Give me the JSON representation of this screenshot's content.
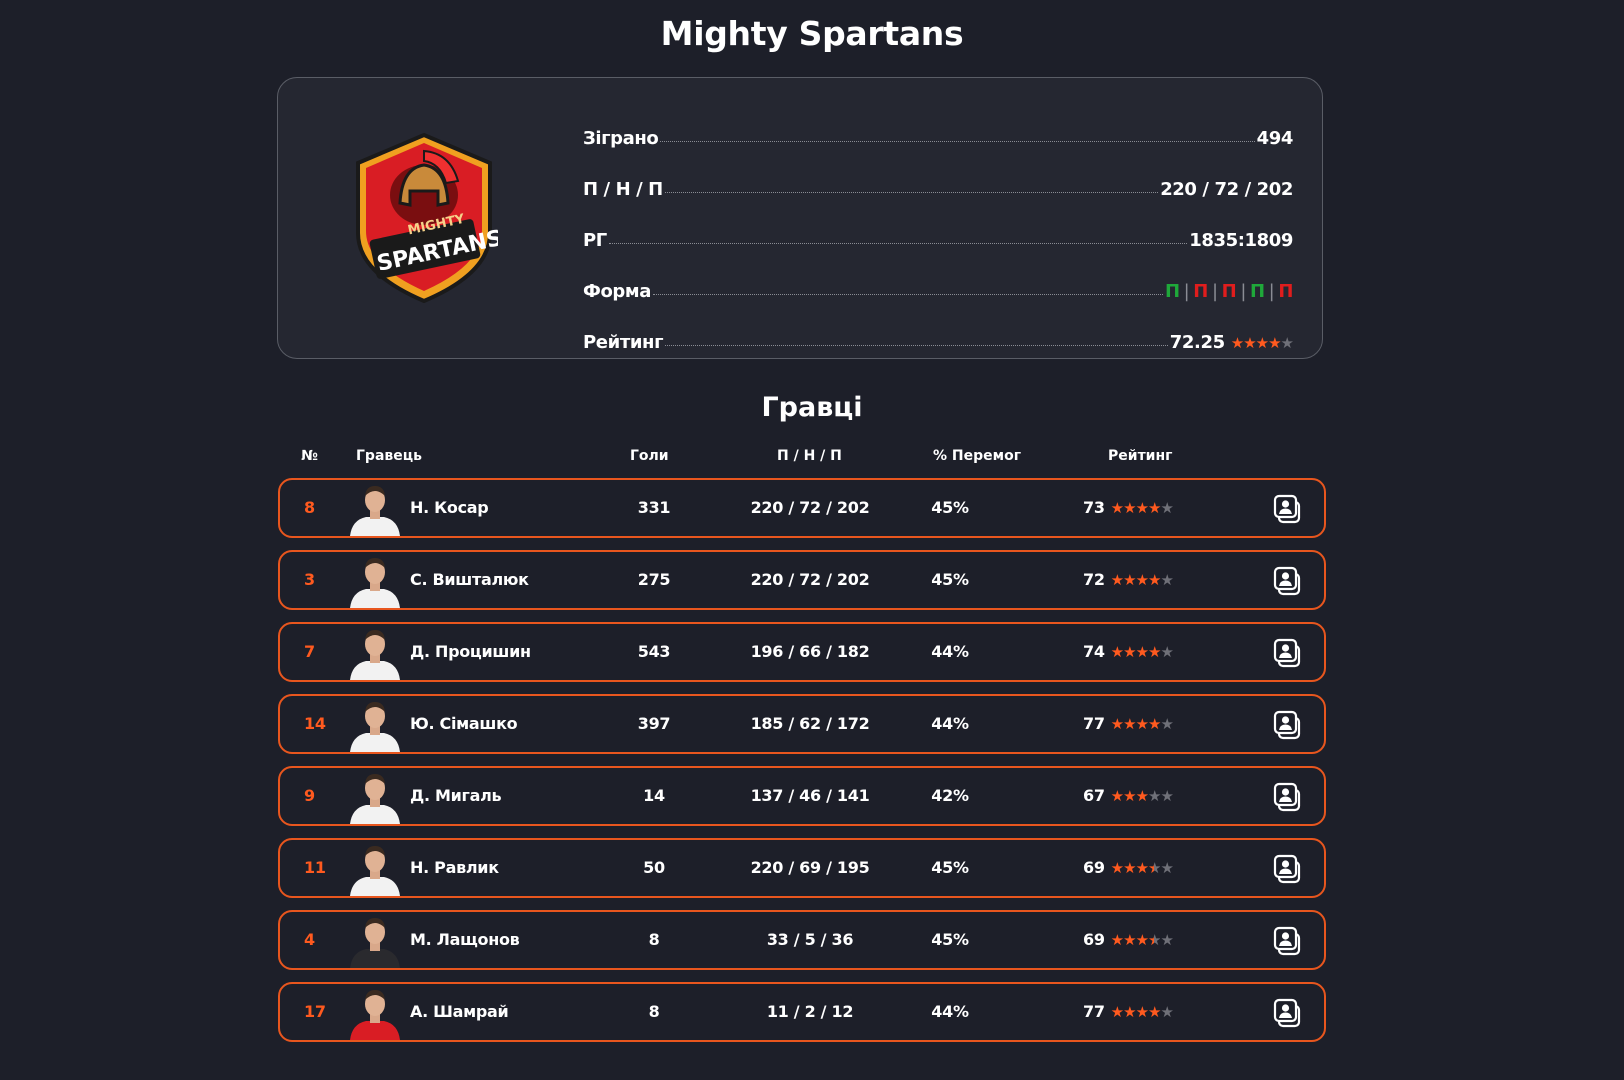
{
  "team": {
    "name": "Mighty Spartans",
    "logo_text_top": "MIGHTY",
    "logo_text_bottom": "SPARTANS",
    "stats": {
      "played_label": "Зіграно",
      "played_value": "494",
      "wdl_label": "П / Н / П",
      "wdl_value": "220 / 72 / 202",
      "gd_label": "РГ",
      "gd_value": "1835:1809",
      "form_label": "Форма",
      "form": [
        {
          "letter": "П",
          "color": "#1fa83a"
        },
        {
          "letter": "П",
          "color": "#e01d1d"
        },
        {
          "letter": "П",
          "color": "#e01d1d"
        },
        {
          "letter": "П",
          "color": "#1fa83a"
        },
        {
          "letter": "П",
          "color": "#e01d1d"
        }
      ],
      "form_separator": "|",
      "rating_label": "Рейтинг",
      "rating_value": "72.25",
      "rating_stars": 4
    }
  },
  "players_title": "Гравці",
  "columns": {
    "num": "№",
    "player": "Гравець",
    "goals": "Голи",
    "wdl": "П / Н / П",
    "win_pct": "% Перемог",
    "rating": "Рейтинг"
  },
  "players": [
    {
      "num": "8",
      "name": "Н. Косар",
      "goals": "331",
      "wdl": "220 / 72 / 202",
      "win_pct": "45%",
      "rating": "73",
      "stars": 4,
      "shirt": "#f2f2f2"
    },
    {
      "num": "3",
      "name": "С. Вишталюк",
      "goals": "275",
      "wdl": "220 / 72 / 202",
      "win_pct": "45%",
      "rating": "72",
      "stars": 4,
      "shirt": "#f2f2f2"
    },
    {
      "num": "7",
      "name": "Д. Процишин",
      "goals": "543",
      "wdl": "196 / 66 / 182",
      "win_pct": "44%",
      "rating": "74",
      "stars": 4,
      "shirt": "#f2f2f2"
    },
    {
      "num": "14",
      "name": "Ю. Сімашко",
      "goals": "397",
      "wdl": "185 / 62 / 172",
      "win_pct": "44%",
      "rating": "77",
      "stars": 4,
      "shirt": "#f2f2f2"
    },
    {
      "num": "9",
      "name": "Д. Мигаль",
      "goals": "14",
      "wdl": "137 / 46 / 141",
      "win_pct": "42%",
      "rating": "67",
      "stars": 3,
      "shirt": "#f2f2f2"
    },
    {
      "num": "11",
      "name": "Н. Равлик",
      "goals": "50",
      "wdl": "220 / 69 / 195",
      "win_pct": "45%",
      "rating": "69",
      "stars": 3.5,
      "shirt": "#f2f2f2"
    },
    {
      "num": "4",
      "name": "М. Лащонов",
      "goals": "8",
      "wdl": "33 / 5 / 36",
      "win_pct": "45%",
      "rating": "69",
      "stars": 3.5,
      "shirt": "#2a2a2e"
    },
    {
      "num": "17",
      "name": "А. Шамрай",
      "goals": "8",
      "wdl": "11 / 2 / 12",
      "win_pct": "44%",
      "rating": "77",
      "stars": 4,
      "shirt": "#d91d24"
    }
  ],
  "colors": {
    "accent": "#ff5a1f",
    "border": "#e8561e",
    "bg": "#1d1f29",
    "card": "#252731",
    "star_off": "#6f7078"
  },
  "icons": {
    "player_card": "contact-card-icon",
    "star": "star-icon"
  }
}
